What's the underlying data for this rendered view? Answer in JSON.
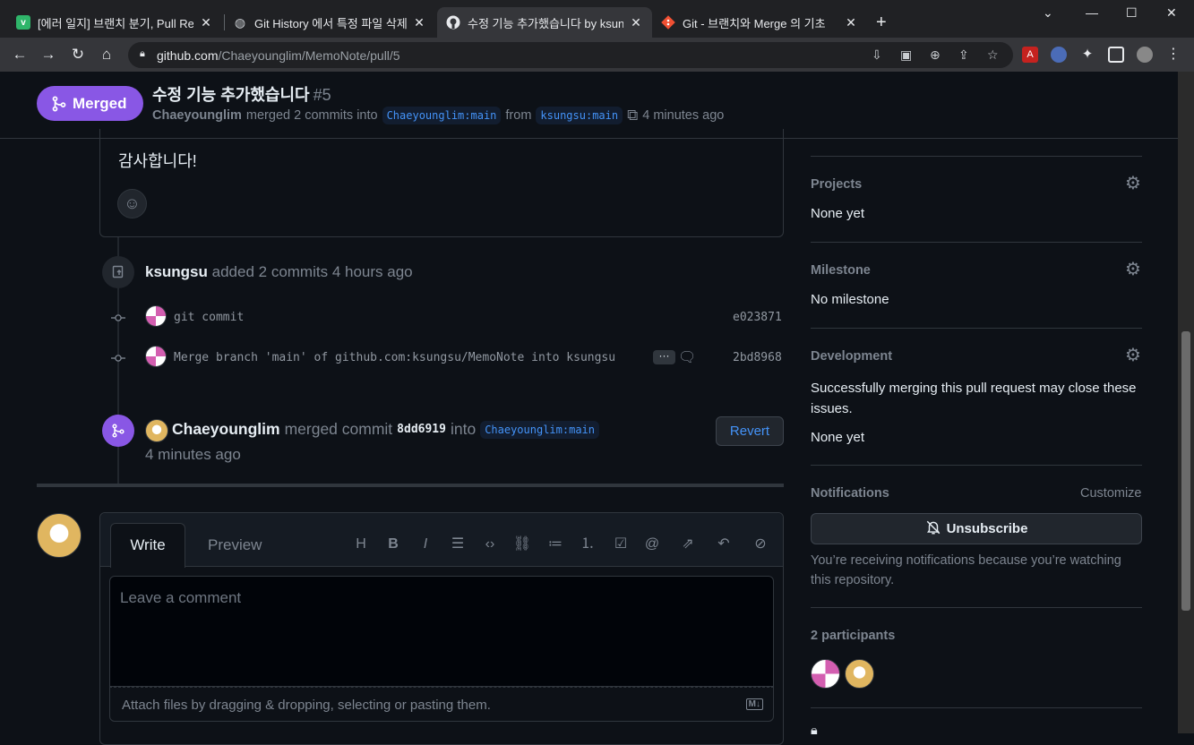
{
  "browser": {
    "tabs": [
      {
        "title": "[에러 일지] 브랜치 분기, Pull Req",
        "favicon": "v",
        "active": false
      },
      {
        "title": "Git History 에서 특정 파일 삭제하",
        "favicon": "globe-icon",
        "active": false
      },
      {
        "title": "수정 기능 추가했습니다 by ksung",
        "favicon": "github-icon",
        "active": true
      },
      {
        "title": "Git - 브랜치와 Merge 의 기초",
        "favicon": "git-icon",
        "active": false
      }
    ],
    "url_host": "github.com",
    "url_path": "/Chaeyounglim/MemoNote/pull/5"
  },
  "header": {
    "state_label": "Merged",
    "title": "수정 기능 추가했습니다",
    "number": "#5",
    "author": "Chaeyounglim",
    "merged_text": "merged 2 commits into",
    "base_branch": "Chaeyounglim:main",
    "from_text": "from",
    "head_branch": "ksungsu:main",
    "time": "4 minutes ago"
  },
  "comment": {
    "body": "감사합니다!"
  },
  "timeline": {
    "commits_event": {
      "actor": "ksungsu",
      "action": "added 2 commits 4 hours ago"
    },
    "commits": [
      {
        "message": "git commit",
        "sha": "e023871"
      },
      {
        "message": "Merge branch 'main' of github.com:ksungsu/MemoNote into ksungsu",
        "sha": "2bd8968"
      }
    ],
    "merge_event": {
      "actor": "Chaeyounglim",
      "action": "merged commit",
      "sha": "8dd6919",
      "into": "into",
      "branch": "Chaeyounglim:main",
      "time": "4 minutes ago",
      "revert_label": "Revert"
    }
  },
  "editor": {
    "write_tab": "Write",
    "preview_tab": "Preview",
    "placeholder": "Leave a comment",
    "attach_text": "Attach files by dragging & dropping, selecting or pasting them.",
    "md_badge": "M↓"
  },
  "sidebar": {
    "projects": {
      "heading": "Projects",
      "value": "None yet"
    },
    "milestone": {
      "heading": "Milestone",
      "value": "No milestone"
    },
    "development": {
      "heading": "Development",
      "description": "Successfully merging this pull request may close these issues.",
      "value": "None yet"
    },
    "notifications": {
      "heading": "Notifications",
      "customize": "Customize",
      "button": "Unsubscribe",
      "reason": "You’re receiving notifications because you’re watching this repository."
    },
    "participants": {
      "heading": "2 participants"
    }
  }
}
